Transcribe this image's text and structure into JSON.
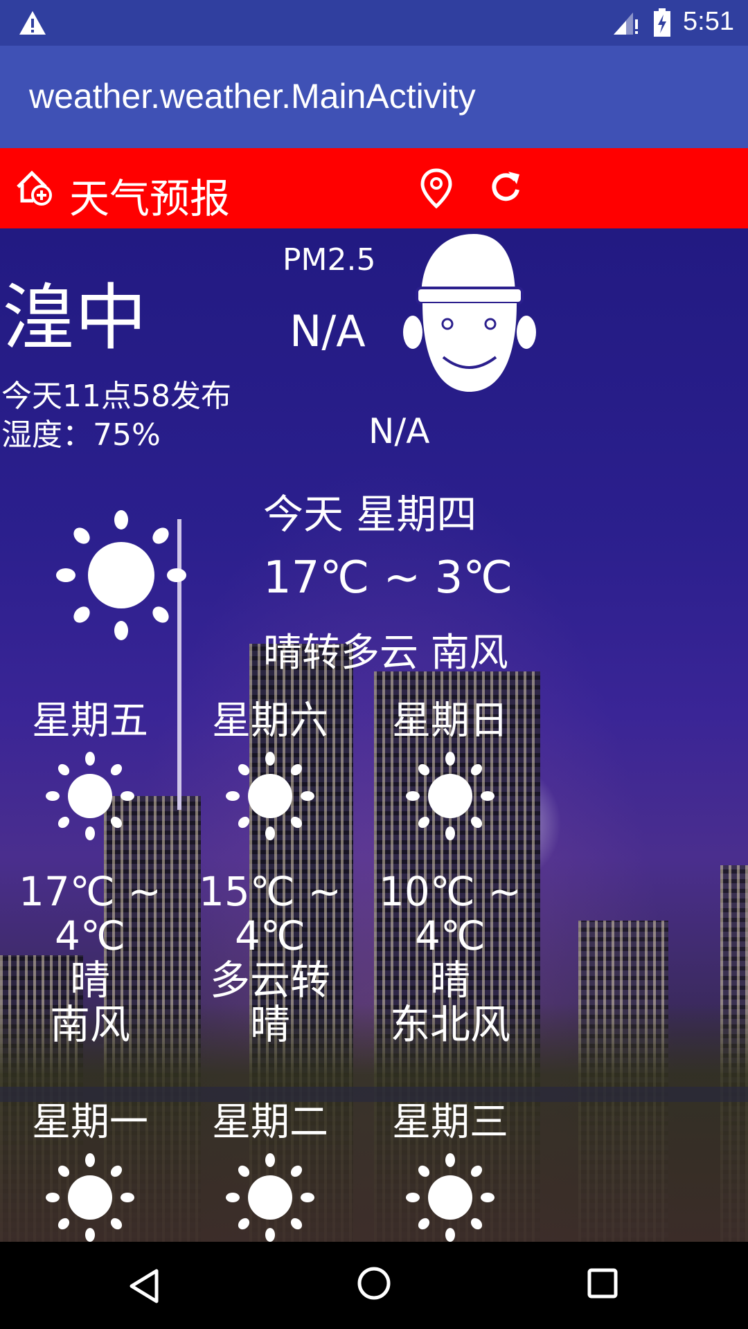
{
  "status_bar": {
    "time": "5:51"
  },
  "app_bar": {
    "title": "weather.weather.MainActivity"
  },
  "title_bar": {
    "title": "天气预报"
  },
  "current": {
    "city": "湟中",
    "publish_time": "今天11点58发布",
    "humidity": "湿度：75%",
    "pm25_label": "PM2.5",
    "pm25_value": "N/A",
    "air_quality": "N/A"
  },
  "today": {
    "day": "今天 星期四",
    "temp_range": "17℃ ~ 3℃",
    "description": "晴转多云 南风",
    "icon": "sun-icon"
  },
  "forecast": [
    {
      "day": "星期五",
      "temp_high": "17℃ ~",
      "temp_low": "4℃",
      "weather": "晴",
      "wind": "南风",
      "icon": "sun-icon"
    },
    {
      "day": "星期六",
      "temp_high": "15℃ ~",
      "temp_low": "4℃",
      "weather": "多云转",
      "wind": "晴",
      "icon": "sun-icon"
    },
    {
      "day": "星期日",
      "temp_high": "10℃ ~",
      "temp_low": "4℃",
      "weather": "晴",
      "wind": "东北风",
      "icon": "sun-icon"
    },
    {
      "day": "星期一",
      "icon": "sun-icon"
    },
    {
      "day": "星期二",
      "icon": "sun-icon"
    },
    {
      "day": "星期三",
      "icon": "sun-icon"
    }
  ],
  "colors": {
    "status_bar": "#303F9F",
    "app_bar": "#3F51B5",
    "title_bar": "#FF0000"
  }
}
